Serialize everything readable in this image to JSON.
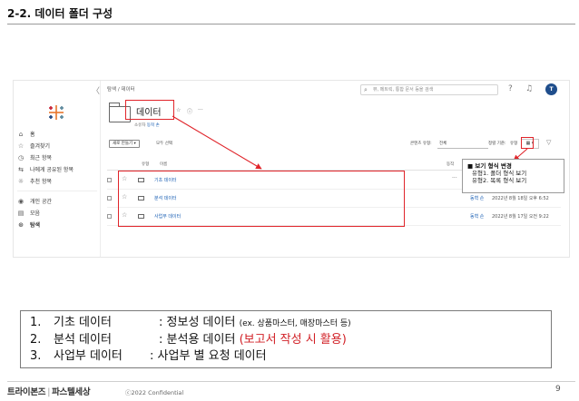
{
  "slide": {
    "title": "2-2. 데이터 폴더 구성",
    "page_number": "9"
  },
  "app": {
    "collapse_glyph": "〈",
    "breadcrumb": "탐색 / 데이터",
    "search_placeholder": "뷰, 메트릭, 통합 문서 등을 검색",
    "avatar_initial": "T",
    "sidebar": [
      {
        "label": "홈",
        "icon": "home-icon"
      },
      {
        "label": "즐겨찾기",
        "icon": "star-icon"
      },
      {
        "label": "최근 항목",
        "icon": "clock-icon"
      },
      {
        "label": "나에게 공유된 항목",
        "icon": "share-icon"
      },
      {
        "label": "추천 항목",
        "icon": "lightbulb-icon"
      },
      {
        "label": "개인 공간",
        "icon": "person-icon"
      },
      {
        "label": "모음",
        "icon": "collection-icon"
      },
      {
        "label": "탐색",
        "icon": "compass-icon",
        "active": true
      }
    ],
    "page_heading": "데이터",
    "owner_label": "소유자",
    "owner_name": "동혁 손",
    "new_button": "새로 만들기 ▾",
    "select_all": "모두 선택",
    "content_type_label": "콘텐츠 유형:",
    "content_type_value": "전체",
    "sort_label": "정렬 기준:",
    "sort_value": "유형",
    "view_toggle": "▦ ▾",
    "columns": {
      "type": "유형",
      "name": "이름",
      "actions": "동작"
    },
    "rows": [
      {
        "name": "기초 데이터",
        "owner": "",
        "modified": "",
        "more": "···"
      },
      {
        "name": "분석 데이터",
        "owner": "동혁 손",
        "modified": "2022년 8월 18일 오후 6:52",
        "more": "···"
      },
      {
        "name": "사업부 데이터",
        "owner": "동혁 손",
        "modified": "2022년 8월 17일 오전 9:22",
        "more": "···"
      }
    ]
  },
  "tooltip": {
    "title": "■ 보기 형식 변경",
    "line1": "유형1. 폴더 형식 보기",
    "line2": "유형2. 목록 형식 보기"
  },
  "note": {
    "items": [
      {
        "num": "1.",
        "label": "기초 데이터",
        "sep": ":",
        "desc": "정보성 데이터",
        "extra": "(ex. 상품마스터, 매장마스터 등)",
        "red": ""
      },
      {
        "num": "2.",
        "label": "분석 데이터",
        "sep": ":",
        "desc": "분석용 데이터",
        "extra": "",
        "red": "(보고서 작성 시 활용)"
      },
      {
        "num": "3.",
        "label": "사업부 데이터",
        "sep": ":",
        "desc": "사업부 별 요청 데이터",
        "extra": "",
        "red": ""
      }
    ]
  },
  "footer": {
    "brand1": "트라이본즈",
    "divider": "|",
    "brand2": "파스텔세상",
    "copyright": "ⓒ2022 Confidential"
  },
  "colors": {
    "accent_red": "#e0242a",
    "link_blue": "#1a5fb4",
    "avatar_bg": "#1f4e8c"
  }
}
